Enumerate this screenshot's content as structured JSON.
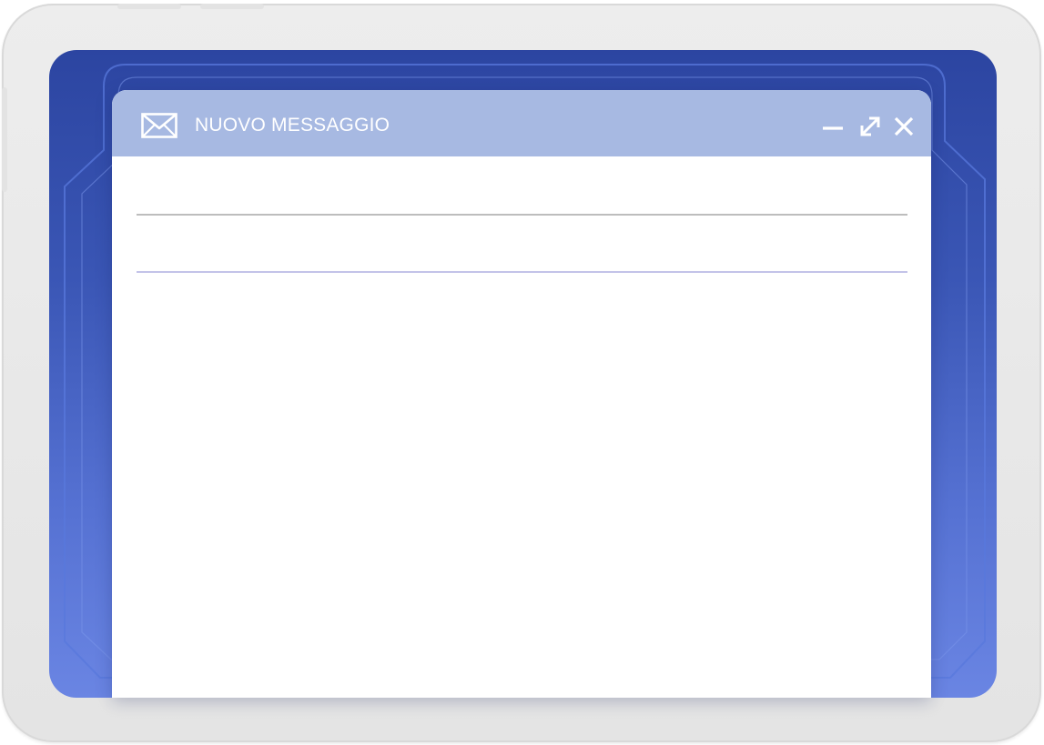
{
  "window": {
    "title": "NUOVO MESSAGGIO",
    "icon": "envelope-icon",
    "controls": [
      "minimize-icon",
      "maximize-icon",
      "close-icon"
    ]
  },
  "colors": {
    "frame": "#e8e8e8",
    "screen_top": "#2c45a1",
    "screen_bottom": "#6a85e3",
    "titlebar": "#a7b9e2",
    "window_bg": "#ffffff"
  }
}
